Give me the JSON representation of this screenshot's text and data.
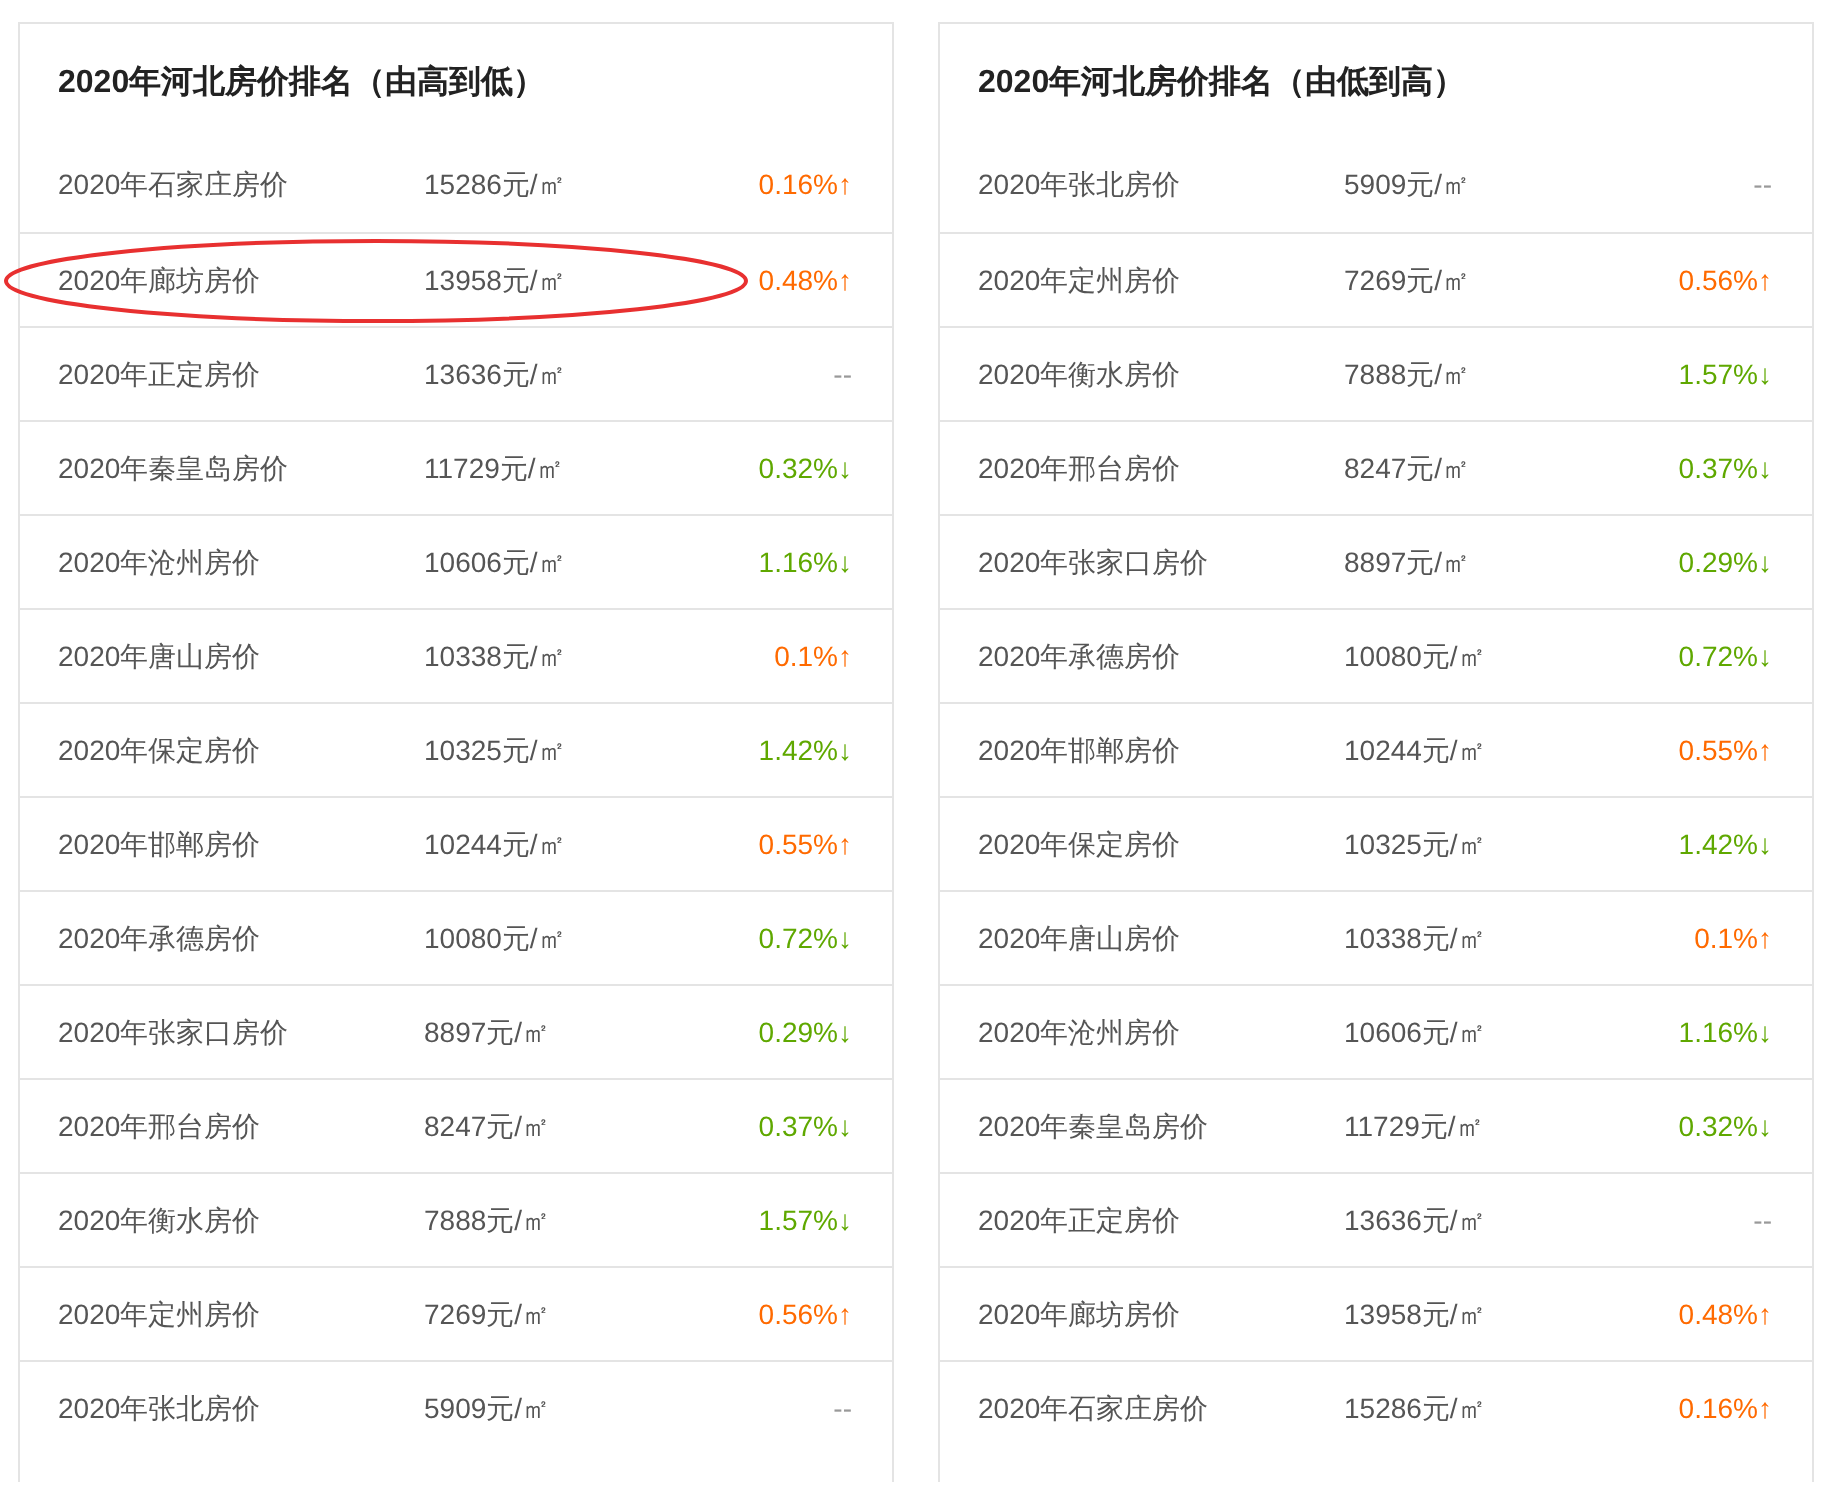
{
  "panels": [
    {
      "title": "2020年河北房价排名（由高到低）",
      "rows": [
        {
          "name": "2020年石家庄房价",
          "price": "15286元/㎡",
          "change": "0.16%↑",
          "kind": "up",
          "circled": false
        },
        {
          "name": "2020年廊坊房价",
          "price": "13958元/㎡",
          "change": "0.48%↑",
          "kind": "up",
          "circled": true
        },
        {
          "name": "2020年正定房价",
          "price": "13636元/㎡",
          "change": "--",
          "kind": "none",
          "circled": false
        },
        {
          "name": "2020年秦皇岛房价",
          "price": "11729元/㎡",
          "change": "0.32%↓",
          "kind": "down",
          "circled": false
        },
        {
          "name": "2020年沧州房价",
          "price": "10606元/㎡",
          "change": "1.16%↓",
          "kind": "down",
          "circled": false
        },
        {
          "name": "2020年唐山房价",
          "price": "10338元/㎡",
          "change": "0.1%↑",
          "kind": "up",
          "circled": false
        },
        {
          "name": "2020年保定房价",
          "price": "10325元/㎡",
          "change": "1.42%↓",
          "kind": "down",
          "circled": false
        },
        {
          "name": "2020年邯郸房价",
          "price": "10244元/㎡",
          "change": "0.55%↑",
          "kind": "up",
          "circled": false
        },
        {
          "name": "2020年承德房价",
          "price": "10080元/㎡",
          "change": "0.72%↓",
          "kind": "down",
          "circled": false
        },
        {
          "name": "2020年张家口房价",
          "price": "8897元/㎡",
          "change": "0.29%↓",
          "kind": "down",
          "circled": false
        },
        {
          "name": "2020年邢台房价",
          "price": "8247元/㎡",
          "change": "0.37%↓",
          "kind": "down",
          "circled": false
        },
        {
          "name": "2020年衡水房价",
          "price": "7888元/㎡",
          "change": "1.57%↓",
          "kind": "down",
          "circled": false
        },
        {
          "name": "2020年定州房价",
          "price": "7269元/㎡",
          "change": "0.56%↑",
          "kind": "up",
          "circled": false
        },
        {
          "name": "2020年张北房价",
          "price": "5909元/㎡",
          "change": "--",
          "kind": "none",
          "circled": false
        }
      ]
    },
    {
      "title": "2020年河北房价排名（由低到高）",
      "rows": [
        {
          "name": "2020年张北房价",
          "price": "5909元/㎡",
          "change": "--",
          "kind": "none",
          "circled": false
        },
        {
          "name": "2020年定州房价",
          "price": "7269元/㎡",
          "change": "0.56%↑",
          "kind": "up",
          "circled": false
        },
        {
          "name": "2020年衡水房价",
          "price": "7888元/㎡",
          "change": "1.57%↓",
          "kind": "down",
          "circled": false
        },
        {
          "name": "2020年邢台房价",
          "price": "8247元/㎡",
          "change": "0.37%↓",
          "kind": "down",
          "circled": false
        },
        {
          "name": "2020年张家口房价",
          "price": "8897元/㎡",
          "change": "0.29%↓",
          "kind": "down",
          "circled": false
        },
        {
          "name": "2020年承德房价",
          "price": "10080元/㎡",
          "change": "0.72%↓",
          "kind": "down",
          "circled": false
        },
        {
          "name": "2020年邯郸房价",
          "price": "10244元/㎡",
          "change": "0.55%↑",
          "kind": "up",
          "circled": false
        },
        {
          "name": "2020年保定房价",
          "price": "10325元/㎡",
          "change": "1.42%↓",
          "kind": "down",
          "circled": false
        },
        {
          "name": "2020年唐山房价",
          "price": "10338元/㎡",
          "change": "0.1%↑",
          "kind": "up",
          "circled": false
        },
        {
          "name": "2020年沧州房价",
          "price": "10606元/㎡",
          "change": "1.16%↓",
          "kind": "down",
          "circled": false
        },
        {
          "name": "2020年秦皇岛房价",
          "price": "11729元/㎡",
          "change": "0.32%↓",
          "kind": "down",
          "circled": false
        },
        {
          "name": "2020年正定房价",
          "price": "13636元/㎡",
          "change": "--",
          "kind": "none",
          "circled": false
        },
        {
          "name": "2020年廊坊房价",
          "price": "13958元/㎡",
          "change": "0.48%↑",
          "kind": "up",
          "circled": false
        },
        {
          "name": "2020年石家庄房价",
          "price": "15286元/㎡",
          "change": "0.16%↑",
          "kind": "up",
          "circled": false
        }
      ]
    }
  ]
}
